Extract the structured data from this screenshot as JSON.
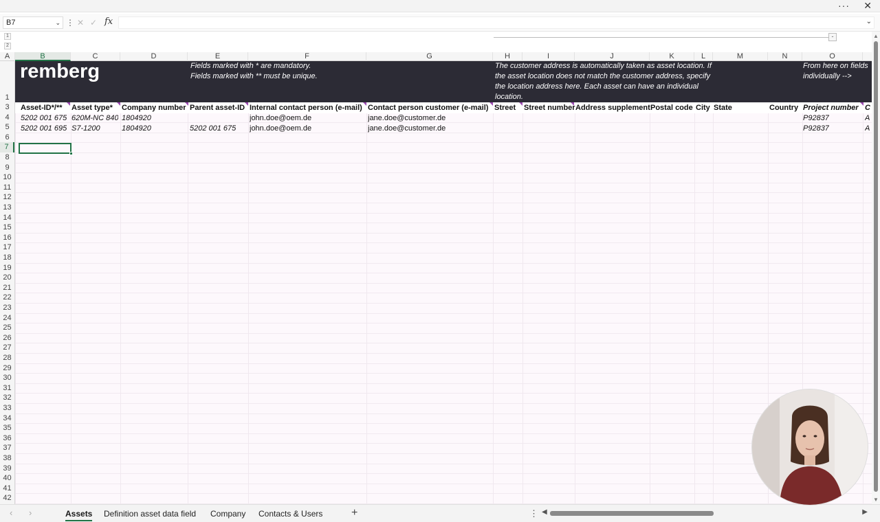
{
  "window": {
    "more_label": "···",
    "close_label": "✕"
  },
  "formula_bar": {
    "name_box": "B7",
    "fx_label": "fx",
    "value": ""
  },
  "outline": {
    "level1": "1",
    "level2": "2",
    "collapse": "-"
  },
  "column_headers": [
    "A",
    "B",
    "C",
    "D",
    "E",
    "F",
    "G",
    "H",
    "I",
    "J",
    "K",
    "L",
    "M",
    "N",
    "O"
  ],
  "selected_column": "B",
  "row_numbers": [
    "1",
    "3",
    "4",
    "5",
    "6",
    "7",
    "8",
    "9",
    "10",
    "11",
    "12",
    "13",
    "14",
    "15",
    "16",
    "17",
    "18",
    "19",
    "20",
    "21",
    "22",
    "23",
    "24",
    "25",
    "26",
    "27",
    "28",
    "29",
    "30",
    "31",
    "32",
    "33",
    "34",
    "35",
    "36",
    "37",
    "38",
    "39",
    "40",
    "41",
    "42"
  ],
  "selected_row": "7",
  "banner": {
    "logo": "remberg",
    "note1": "Fields marked with * are mandatory.\nFields marked with ** must be unique.",
    "note2": "The customer address is automatically taken as asset location. If\nthe asset location does not match the customer address, specify\nthe location address here. Each asset can have an individual\nlocation.",
    "note3": "From here on fields\nindividually -->"
  },
  "headers": [
    "Asset-ID*/**",
    "Asset type*",
    "Company number",
    "Parent asset-ID",
    "Internal contact person (e-mail)",
    "Contact person customer (e-mail)",
    "Street",
    "Street number",
    "Address supplement",
    "Postal code",
    "City",
    "State",
    "Country",
    "Project number",
    "C"
  ],
  "rows": [
    [
      "5202 001 675",
      "620M-NC 840",
      "1804920",
      "",
      "john.doe@oem.de",
      "jane.doe@customer.de",
      "P92837",
      "A"
    ],
    [
      "5202 001 695",
      "S7-1200",
      "1804920",
      "5202 001 675",
      "john.doe@oem.de",
      "jane.doe@customer.de",
      "P92837",
      "A"
    ]
  ],
  "sheets": [
    {
      "label": "Assets",
      "active": true
    },
    {
      "label": "Definition asset data field",
      "active": false
    },
    {
      "label": "Company",
      "active": false
    },
    {
      "label": "Contacts & Users",
      "active": false
    }
  ],
  "add_sheet": "+",
  "tab_menu": "⋮",
  "colors": {
    "banner_bg": "#2c2b35",
    "accent": "#217346",
    "marker": "#9b4bb1"
  }
}
